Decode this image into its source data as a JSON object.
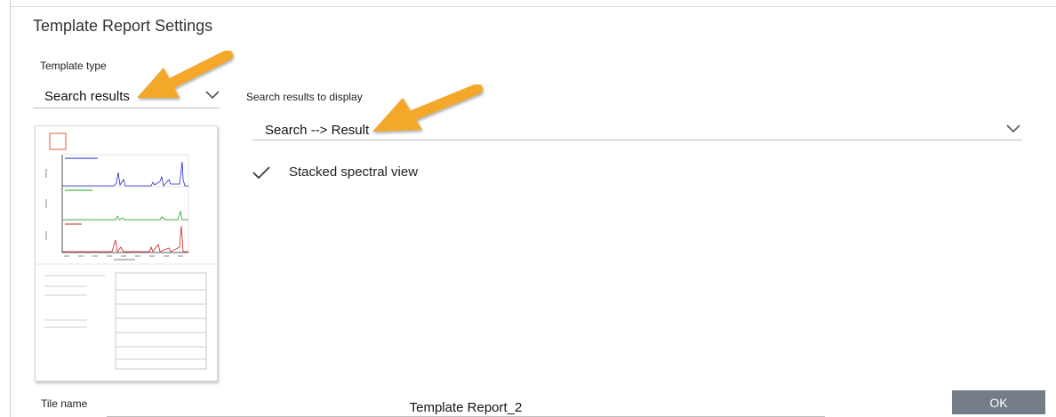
{
  "dialog": {
    "title": "Template Report Settings"
  },
  "template_type": {
    "label": "Template type",
    "selected": "Search results",
    "chevron_icon": "chevron-down-icon"
  },
  "search_results": {
    "label": "Search results to display",
    "selected": "Search --> Result",
    "chevron_icon": "chevron-down-icon"
  },
  "stacked_view": {
    "label": "Stacked spectral view",
    "checked": true,
    "icon": "checkmark-icon"
  },
  "preview": {
    "description_icon": "report-thumbnail",
    "series_colors": [
      "#2323c8",
      "#27a027",
      "#d02020"
    ]
  },
  "tile_name": {
    "label": "Tile name",
    "value": "Template Report_2"
  },
  "ok_button": {
    "label": "OK"
  },
  "annotation_color": "#f4a82a"
}
